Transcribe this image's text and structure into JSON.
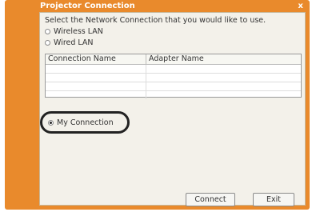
{
  "window": {
    "title": "Projector Connection",
    "close_label": "x"
  },
  "prompt": "Select the Network Connection that you would like to use.",
  "options": [
    {
      "label": "Wireless LAN",
      "checked": false
    },
    {
      "label": "Wired LAN",
      "checked": false
    },
    {
      "label": "My Connection",
      "checked": true
    }
  ],
  "table": {
    "columns": [
      "Connection Name",
      "Adapter Name"
    ],
    "rows": []
  },
  "buttons": {
    "connect": "Connect",
    "exit": "Exit"
  },
  "colors": {
    "frame": "#e98a2c",
    "panel": "#f3f1ea",
    "highlight": "#222222"
  }
}
